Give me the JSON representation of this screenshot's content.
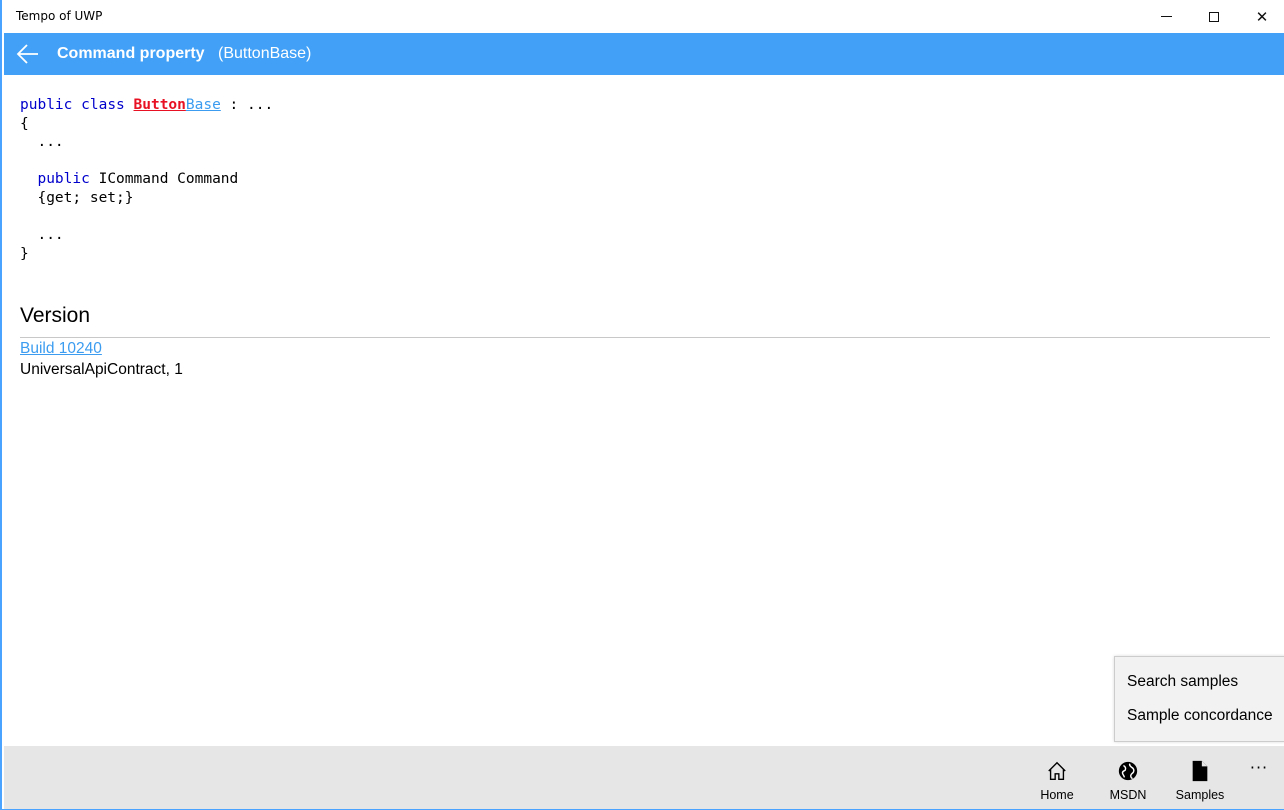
{
  "window": {
    "title": "Tempo of UWP",
    "minimize_glyph": "",
    "close_glyph": "✕"
  },
  "header": {
    "title": "Command property",
    "subtitle": "(ButtonBase)",
    "accent_color": "#42a1f6",
    "back_icon": "back-arrow-icon"
  },
  "code": {
    "line1": {
      "kw1": "public",
      "kw2": "class",
      "class_part1": "Button",
      "class_part2": "Base",
      "rest": " : ..."
    },
    "line2": "{",
    "line3": "  ...",
    "line5": {
      "kw": "public",
      "rest": " ICommand Command"
    },
    "line6": "  {get; set;}",
    "line8": "  ...",
    "line9": "}"
  },
  "version": {
    "heading": "Version",
    "build_link": "Build 10240",
    "contract": "UniversalApiContract, 1"
  },
  "popup_menu": {
    "items": [
      {
        "label": "Search samples"
      },
      {
        "label": "Sample concordance"
      }
    ]
  },
  "command_bar": {
    "buttons": [
      {
        "label": "Home",
        "icon": "home-icon"
      },
      {
        "label": "MSDN",
        "icon": "globe-icon"
      },
      {
        "label": "Samples",
        "icon": "document-icon"
      }
    ],
    "more_label": "···"
  }
}
